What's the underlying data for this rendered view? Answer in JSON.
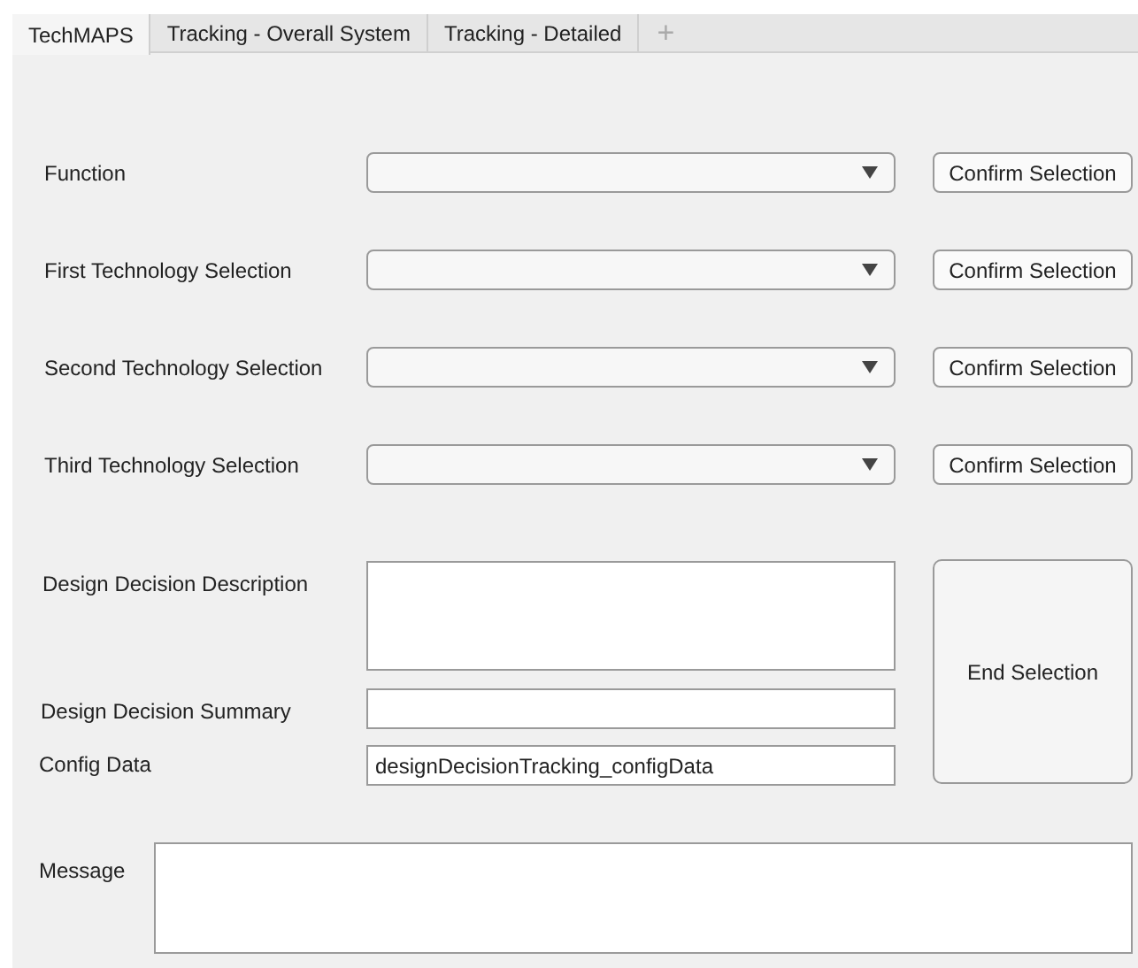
{
  "tabs": [
    {
      "label": "TechMAPS",
      "selected": true
    },
    {
      "label": "Tracking - Overall System",
      "selected": false
    },
    {
      "label": "Tracking - Detailed",
      "selected": false
    }
  ],
  "add_tab": "+",
  "selection_rows": [
    {
      "label": "Function",
      "button": "Confirm Selection"
    },
    {
      "label": "First Technology Selection",
      "button": "Confirm Selection"
    },
    {
      "label": "Second Technology Selection",
      "button": "Confirm Selection"
    },
    {
      "label": "Third Technology Selection",
      "button": "Confirm Selection"
    }
  ],
  "description": {
    "label": "Design Decision Description"
  },
  "summary": {
    "label": "Design Decision Summary"
  },
  "config": {
    "label": "Config Data",
    "value": "designDecisionTracking_configData"
  },
  "end_button": "End Selection",
  "message": {
    "label": "Message"
  }
}
